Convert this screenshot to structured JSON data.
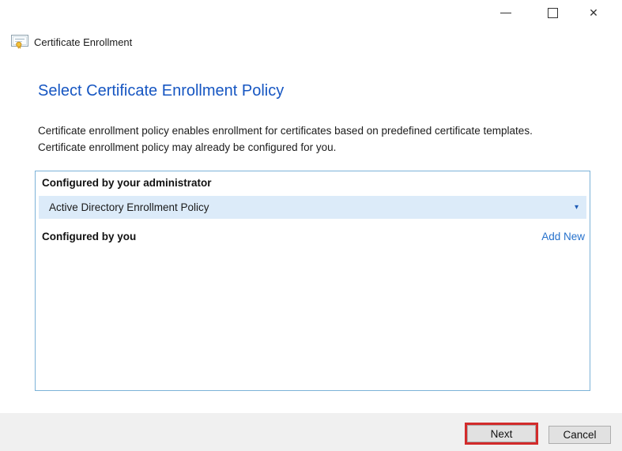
{
  "window": {
    "app_title": "Certificate Enrollment"
  },
  "icons": {
    "close": "✕",
    "dropdown_chevron": "▾"
  },
  "page": {
    "heading": "Select Certificate Enrollment Policy",
    "description_line1": "Certificate enrollment policy enables enrollment for certificates based on predefined certificate templates.",
    "description_line2": "Certificate enrollment policy may already be configured for you."
  },
  "policy_panel": {
    "admin_section_label": "Configured by your administrator",
    "admin_policy_name": "Active Directory Enrollment Policy",
    "user_section_label": "Configured by you",
    "add_new_label": "Add New"
  },
  "footer": {
    "next_label": "Next",
    "cancel_label": "Cancel"
  },
  "colors": {
    "heading_blue": "#1656c2",
    "link_blue": "#2571cc",
    "panel_border_blue": "#7cb2d8",
    "selected_row_bg": "#dcebf9",
    "footer_bg": "#f0f0f0",
    "button_bg": "#e1e1e1",
    "button_border": "#adadad",
    "highlight_red": "#d22b2b"
  }
}
